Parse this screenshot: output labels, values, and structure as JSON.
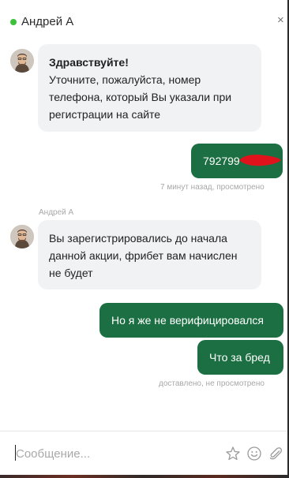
{
  "header": {
    "agent_name": "Андрей А",
    "online_color": "#3cc13b",
    "close_glyph": "×"
  },
  "messages": [
    {
      "direction": "incoming",
      "title": "Здравствуйте!",
      "text": "Уточните, пожалуйста, номер телефона, который Вы указали при регистрации на сайте"
    },
    {
      "direction": "outgoing",
      "text": "792799",
      "status": "7 минут назад, просмотрено"
    },
    {
      "direction": "incoming",
      "sender": "Андрей А",
      "text": "Вы зарегистрировались до начала данной акции, фрибет вам начислен не будет"
    },
    {
      "direction": "outgoing",
      "text": "Но я же не верифицировался"
    },
    {
      "direction": "outgoing",
      "text": "Что за бред",
      "status": "доставлено, не просмотрено"
    }
  ],
  "composer": {
    "placeholder": "Сообщение...",
    "value": "",
    "icons": [
      "star-icon",
      "emoji-icon",
      "attach-icon"
    ]
  },
  "colors": {
    "outgoing_bubble": "#1c6f42",
    "incoming_bubble": "#f1f2f4",
    "redaction": "#e0121b"
  }
}
